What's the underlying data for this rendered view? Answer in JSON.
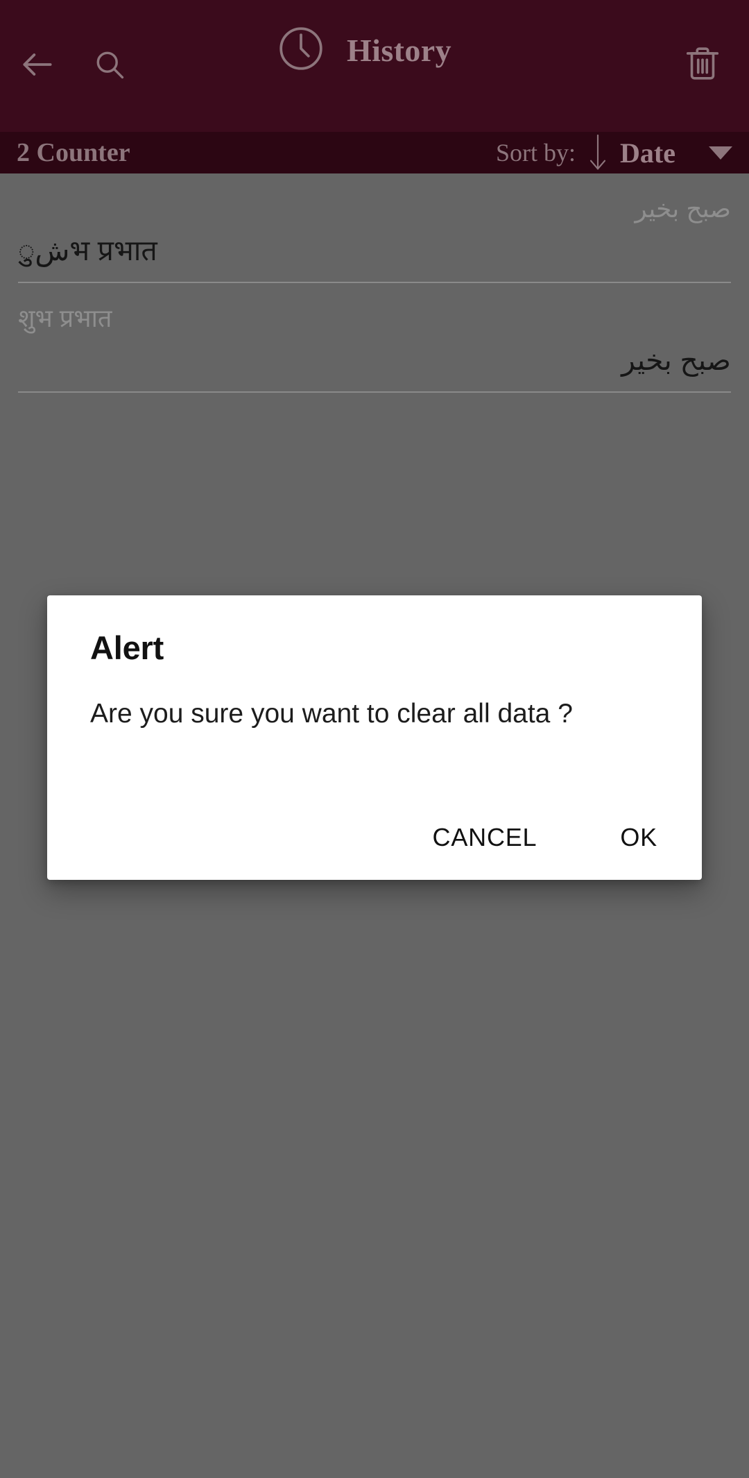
{
  "theme": {
    "appbar_bg": "#3b0b1c",
    "sortbar_bg": "#2c0613",
    "appbar_fg": "#9d8189",
    "scrim_bg": "#656565",
    "dialog_bg": "#ffffff",
    "dialog_fg": "#111111"
  },
  "appbar": {
    "title": "History",
    "back_icon": "arrow-left-icon",
    "search_icon": "search-icon",
    "clock_icon": "clock-icon",
    "delete_icon": "trash-icon"
  },
  "sortbar": {
    "counter_label": "2 Counter",
    "sort_by_label": "Sort by:",
    "sort_direction_icon": "arrow-down-icon",
    "sort_field": "Date",
    "dropdown_icon": "caret-down-icon"
  },
  "history": {
    "entries": [
      {
        "secondary": "صبح بخير",
        "secondary_align": "end",
        "primary": "شुभ प्रभात",
        "primary_align": "start"
      },
      {
        "secondary": "शुभ प्रभात",
        "secondary_align": "start",
        "primary": "صبح بخير",
        "primary_align": "end"
      }
    ]
  },
  "dialog": {
    "title": "Alert",
    "message": "Are you sure you want to clear all data ?",
    "cancel_label": "CANCEL",
    "ok_label": "OK"
  }
}
